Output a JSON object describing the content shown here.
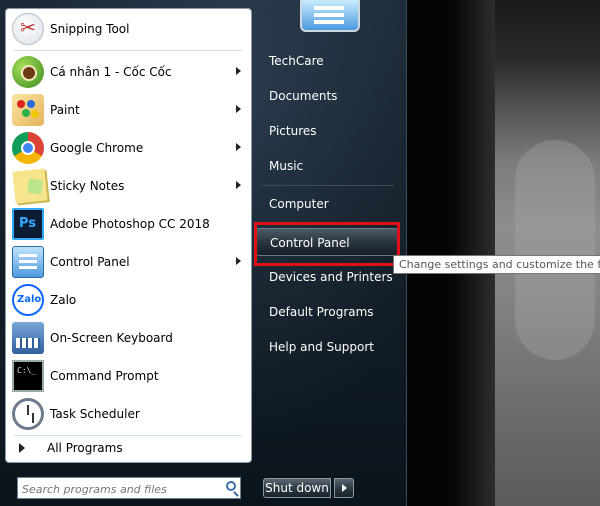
{
  "left_panel": {
    "programs": [
      {
        "label": "Snipping Tool",
        "icon": "snipping-tool-icon",
        "has_submenu": false
      },
      {
        "label": "Cá nhân 1 - Cốc Cốc",
        "icon": "coccoc-icon",
        "has_submenu": true
      },
      {
        "label": "Paint",
        "icon": "paint-icon",
        "has_submenu": true
      },
      {
        "label": "Google Chrome",
        "icon": "chrome-icon",
        "has_submenu": true
      },
      {
        "label": "Sticky Notes",
        "icon": "sticky-notes-icon",
        "has_submenu": true
      },
      {
        "label": "Adobe Photoshop CC 2018",
        "icon": "photoshop-icon",
        "has_submenu": false
      },
      {
        "label": "Control Panel",
        "icon": "control-panel-icon",
        "has_submenu": true
      },
      {
        "label": "Zalo",
        "icon": "zalo-icon",
        "has_submenu": false
      },
      {
        "label": "On-Screen Keyboard",
        "icon": "keyboard-icon",
        "has_submenu": false
      },
      {
        "label": "Command Prompt",
        "icon": "command-prompt-icon",
        "has_submenu": false
      },
      {
        "label": "Task Scheduler",
        "icon": "task-scheduler-icon",
        "has_submenu": false
      }
    ],
    "all_programs": "All Programs",
    "search_placeholder": "Search programs and files"
  },
  "right_panel": {
    "items": [
      {
        "label": "TechCare"
      },
      {
        "label": "Documents"
      },
      {
        "label": "Pictures"
      },
      {
        "label": "Music"
      },
      {
        "label": "Computer"
      },
      {
        "label": "Control Panel",
        "highlighted": true
      },
      {
        "label": "Devices and Printers"
      },
      {
        "label": "Default Programs"
      },
      {
        "label": "Help and Support"
      }
    ],
    "tooltip": "Change settings and customize the functionality of this computer.",
    "shutdown": "Shut down"
  },
  "colors": {
    "highlight_box": "#e0101a"
  }
}
